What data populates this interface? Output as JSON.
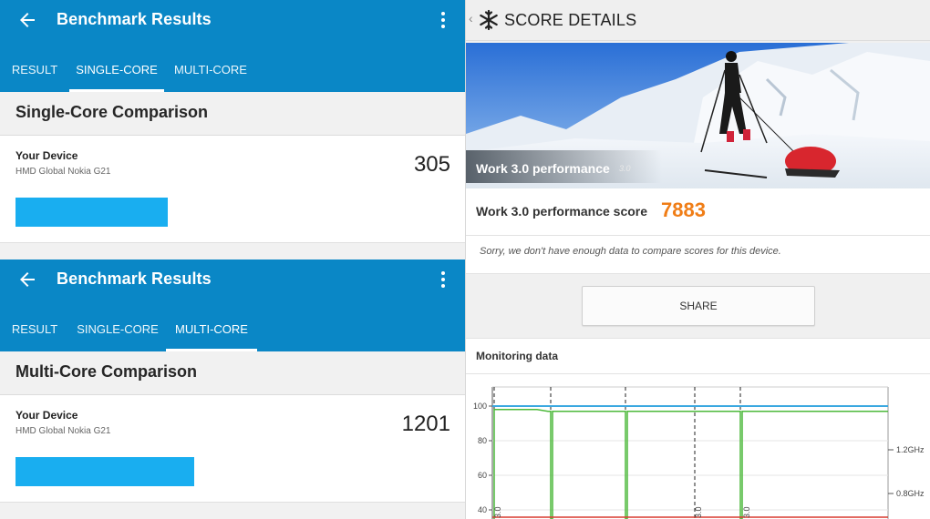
{
  "single_core": {
    "app_title": "Benchmark Results",
    "tabs": [
      {
        "label": "RESULT",
        "active": false
      },
      {
        "label": "SINGLE-CORE",
        "active": true
      },
      {
        "label": "MULTI-CORE",
        "active": false
      }
    ],
    "section_title": "Single-Core Comparison",
    "device_label": "Your Device",
    "device_model": "HMD Global Nokia G21",
    "score": "305",
    "bar_fraction": 0.34
  },
  "multi_core": {
    "app_title": "Benchmark Results",
    "tabs": [
      {
        "label": "RESULT",
        "active": false
      },
      {
        "label": "SINGLE-CORE",
        "active": false
      },
      {
        "label": "MULTI-CORE",
        "active": true
      }
    ],
    "section_title": "Multi-Core Comparison",
    "device_label": "Your Device",
    "device_model": "HMD Global Nokia G21",
    "score": "1201",
    "bar_fraction": 0.4
  },
  "pcmark": {
    "title": "SCORE DETAILS",
    "hero_label": "Work 3.0 performance",
    "hero_version": "3.0",
    "score_label": "Work 3.0 performance score",
    "score_value": "7883",
    "note": "Sorry, we don't have enough data to compare scores for this device.",
    "share_label": "SHARE",
    "monitoring_label": "Monitoring data",
    "colors": {
      "accent_score": "#f07d16",
      "geekbench_blue": "#0a87c6",
      "bar_blue": "#19aef0"
    },
    "chart_data": {
      "type": "line",
      "y_ticks": [
        "100",
        "80",
        "60",
        "40"
      ],
      "freq_ticks": [
        "1.2GHz",
        "0.8GHz"
      ],
      "ylim": [
        40,
        100
      ],
      "series": [
        {
          "color": "#3aa8e0",
          "values": [
            100,
            100
          ]
        },
        {
          "color": "#4cb93a",
          "values": [
            98,
            98
          ]
        },
        {
          "color": "#d83a2e",
          "values": [
            40,
            40
          ]
        }
      ],
      "markers": [
        "3.0",
        "3.0",
        "3.0"
      ]
    }
  }
}
